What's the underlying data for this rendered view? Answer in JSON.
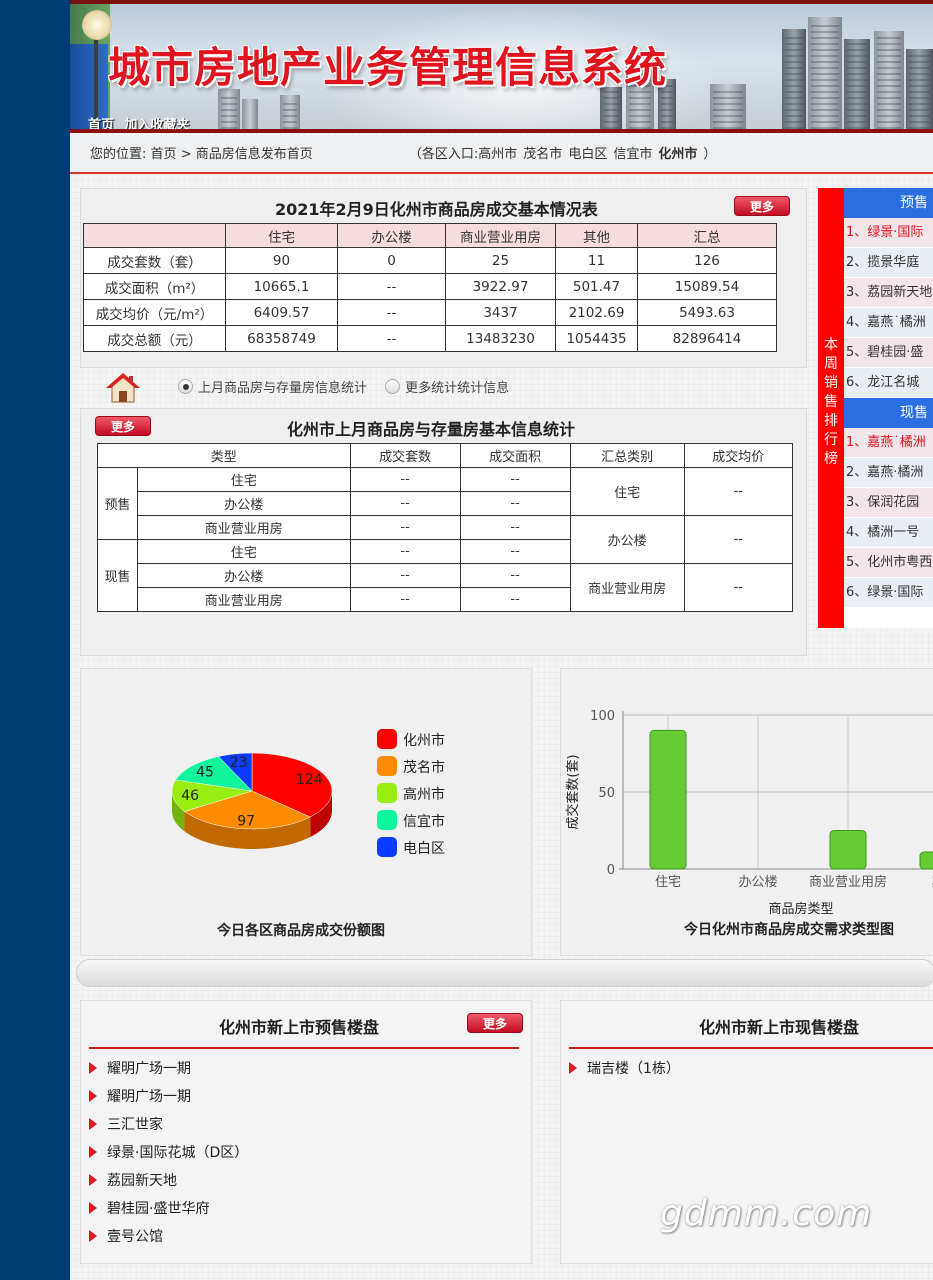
{
  "header": {
    "site_title": "城市房地产业务管理信息系统",
    "links": [
      "首页",
      "加入收藏夹"
    ]
  },
  "breadcrumb": {
    "prefix": "您的位置:",
    "home": "首页",
    "sep": ">",
    "current": "商品房信息发布首页",
    "entry_label": "（各区入口:",
    "districts": [
      "高州市",
      "茂名市",
      "电白区",
      "信宜市"
    ],
    "active_district": "化州市",
    "entry_close": "）"
  },
  "daily_table": {
    "title": "2021年2月9日化州市商品房成交基本情况表",
    "more": "更多",
    "columns": [
      "住宅",
      "办公楼",
      "商业营业用房",
      "其他",
      "汇总"
    ],
    "rows": [
      {
        "label": "成交套数（套）",
        "values": [
          "90",
          "0",
          "25",
          "11",
          "126"
        ]
      },
      {
        "label": "成交面积（m²）",
        "values": [
          "10665.1",
          "--",
          "3922.97",
          "501.47",
          "15089.54"
        ]
      },
      {
        "label": "成交均价（元/m²）",
        "values": [
          "6409.57",
          "--",
          "3437",
          "2102.69",
          "5493.63"
        ]
      },
      {
        "label": "成交总额（元）",
        "values": [
          "68358749",
          "--",
          "13483230",
          "1054435",
          "82896414"
        ]
      }
    ]
  },
  "stats_tabs": {
    "option1": "上月商品房与存量房信息统计",
    "option2": "更多统计统计信息"
  },
  "monthly_table": {
    "title": "化州市上月商品房与存量房基本信息统计",
    "more": "更多",
    "headers": [
      "类型",
      "成交套数",
      "成交面积",
      "汇总类别",
      "成交均价"
    ],
    "groups": [
      {
        "name": "预售",
        "rows": [
          {
            "type": "住宅",
            "count": "--",
            "area": "--"
          },
          {
            "type": "办公楼",
            "count": "--",
            "area": "--"
          },
          {
            "type": "商业营业用房",
            "count": "--",
            "area": "--"
          }
        ]
      },
      {
        "name": "现售",
        "rows": [
          {
            "type": "住宅",
            "count": "--",
            "area": "--"
          },
          {
            "type": "办公楼",
            "count": "--",
            "area": "--"
          },
          {
            "type": "商业营业用房",
            "count": "--",
            "area": "--"
          }
        ]
      }
    ],
    "summary": [
      {
        "category": "住宅",
        "avg": "--"
      },
      {
        "category": "办公楼",
        "avg": "--"
      },
      {
        "category": "商业营业用房",
        "avg": "--"
      }
    ]
  },
  "ranking": {
    "side_label": [
      "本",
      "周",
      "销",
      "售",
      "排",
      "行",
      "榜"
    ],
    "presale_head": "预售",
    "presale_items": [
      "1、绿景·国际",
      "2、揽景华庭",
      "3、荔园新天地",
      "4、嘉燕˙橘洲",
      "5、碧桂园·盛",
      "6、龙江名城"
    ],
    "spot_head": "现售",
    "spot_items": [
      "1、嘉燕˙橘洲",
      "2、嘉燕·橘洲",
      "3、保润花园",
      "4、橘洲一号",
      "5、化州市粤西",
      "6、绿景·国际"
    ]
  },
  "chart_data": [
    {
      "type": "pie",
      "title": "今日各区商品房成交份额图",
      "categories": [
        "化州市",
        "茂名市",
        "高州市",
        "信宜市",
        "电白区"
      ],
      "values": [
        124,
        97,
        46,
        45,
        23
      ],
      "colors": [
        "#ff0000",
        "#ff8c00",
        "#99ee11",
        "#11f59c",
        "#0a3cff"
      ]
    },
    {
      "type": "bar",
      "title": "今日化州市商品房成交需求类型图",
      "categories": [
        "住宅",
        "办公楼",
        "商业营业用房",
        "其"
      ],
      "values": [
        90,
        0,
        25,
        11
      ],
      "xlabel": "商品房类型",
      "ylabel": "成交套数(套)",
      "ylim": [
        0,
        100
      ],
      "yticks": [
        0,
        50,
        100
      ],
      "color": "#66cc33"
    }
  ],
  "presale_list": {
    "title": "化州市新上市预售楼盘",
    "more": "更多",
    "items": [
      "耀明广场一期",
      "耀明广场一期",
      "三汇世家",
      "绿景·国际花城（D区）",
      "荔园新天地",
      "碧桂园·盛世华府",
      "壹号公馆"
    ]
  },
  "spot_list": {
    "title": "化州市新上市现售楼盘",
    "items": [
      "瑞吉楼（1栋）"
    ]
  },
  "watermark": "gdmm.com"
}
